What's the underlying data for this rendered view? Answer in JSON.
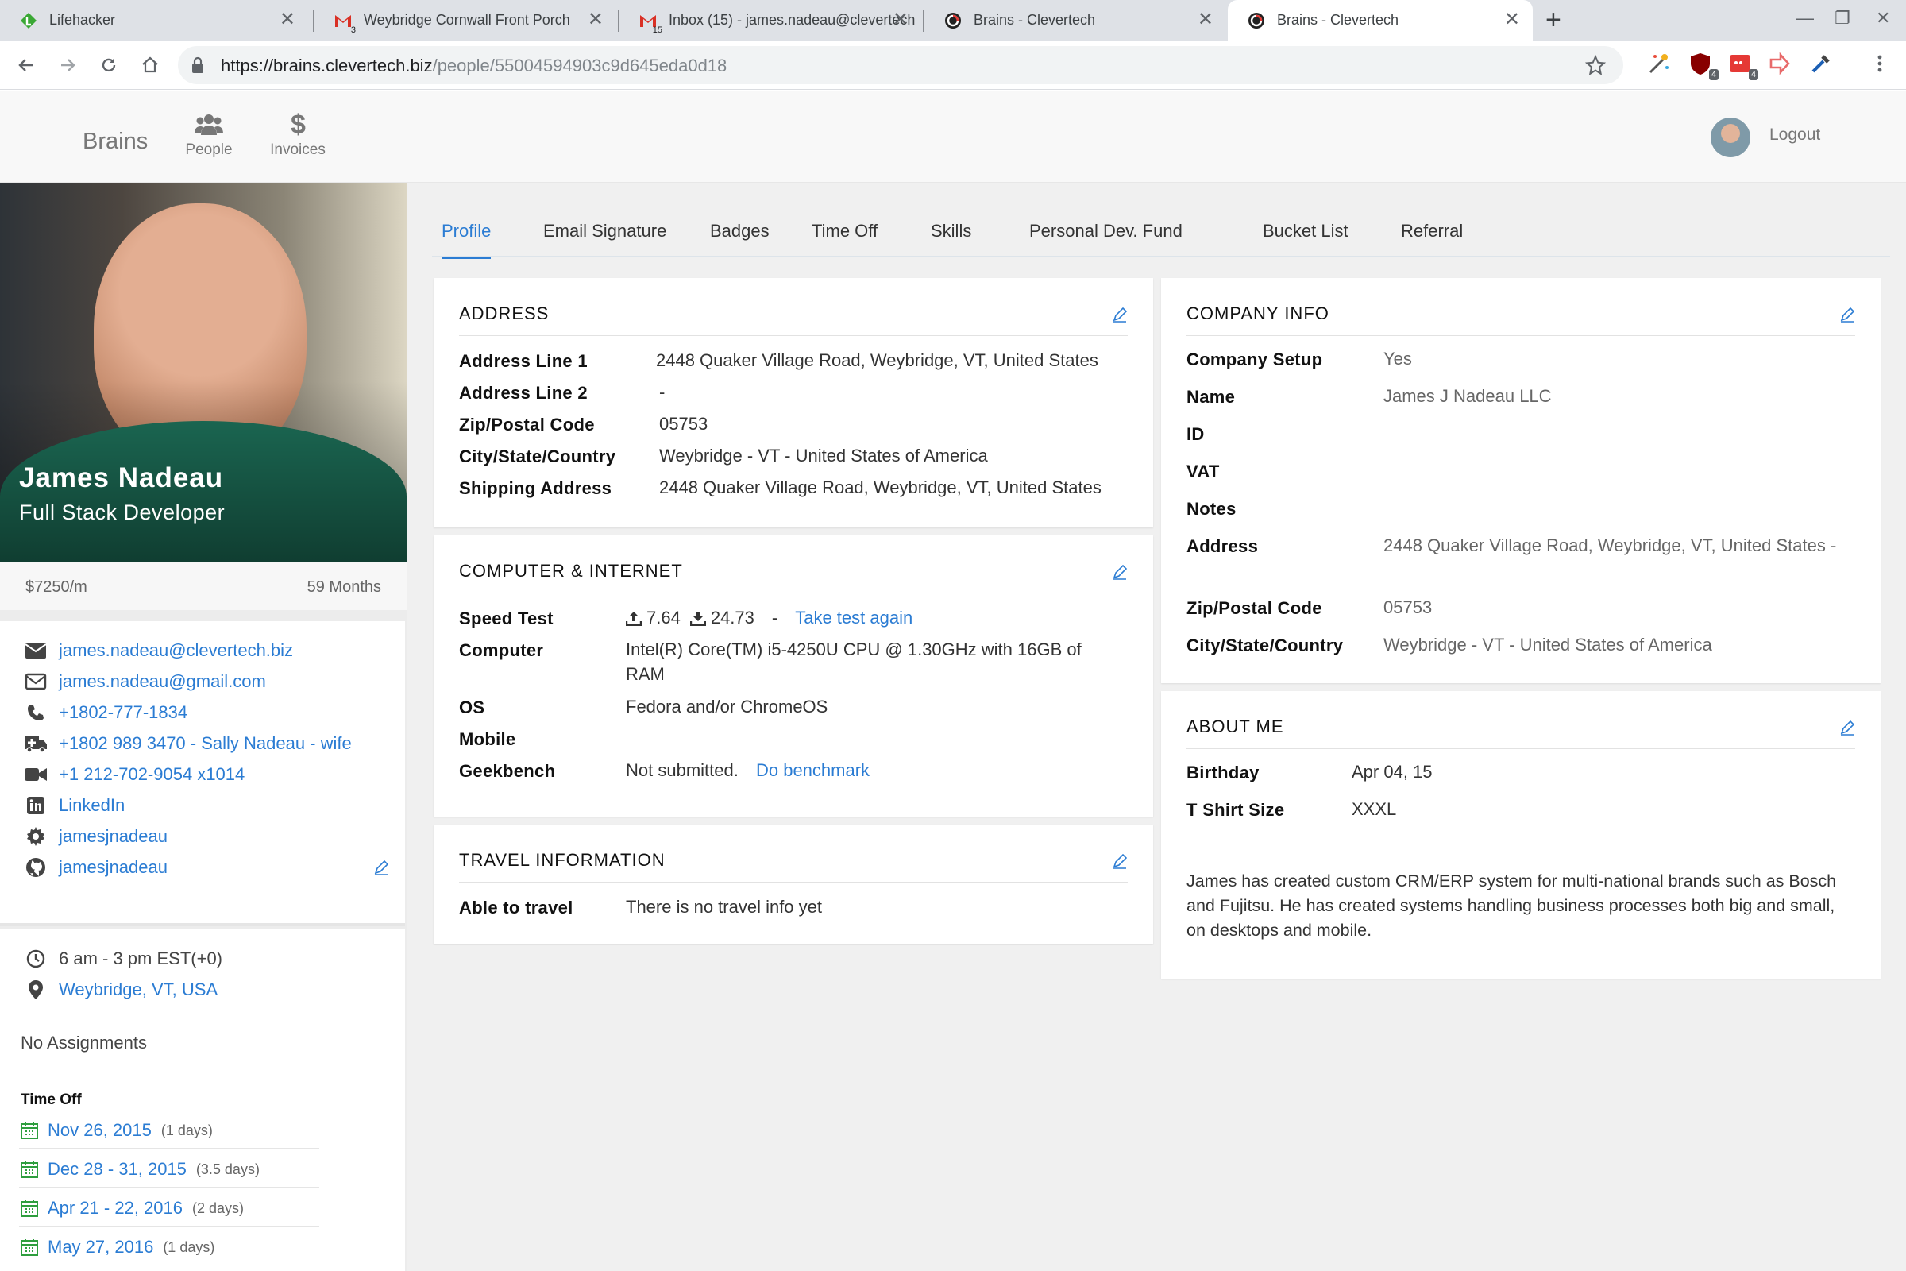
{
  "browser": {
    "tabs": [
      {
        "title": "Lifehacker",
        "favicon": "lifehacker-icon"
      },
      {
        "title": "Weybridge Cornwall Front Porch",
        "favicon": "gmail-icon"
      },
      {
        "title": "Inbox (15) - james.nadeau@clevertech",
        "favicon": "gmail-icon"
      },
      {
        "title": "Brains - Clevertech",
        "favicon": "clevertech-icon"
      },
      {
        "title": "Brains - Clevertech",
        "favicon": "clevertech-icon",
        "active": true
      }
    ],
    "gmail_count_1": "3",
    "gmail_count_2": "15",
    "new_tab": "+",
    "close": "✕",
    "minimize": "—",
    "restore": "❐",
    "win_close": "✕",
    "url_host": "https://brains.clevertech.biz",
    "url_path": "/people/55004594903c9d645eda0d18",
    "extension_badges": [
      "4",
      "4"
    ]
  },
  "appnav": {
    "brand": "Brains",
    "people": "People",
    "invoices": "Invoices",
    "logout": "Logout"
  },
  "profile": {
    "name": "James Nadeau",
    "role": "Full Stack Developer",
    "rate": "$7250/m",
    "tenure": "59 Months",
    "contacts": [
      {
        "icon": "envelope-icon",
        "text": "james.nadeau@clevertech.biz"
      },
      {
        "icon": "envelope-outline-icon",
        "text": "james.nadeau@gmail.com"
      },
      {
        "icon": "phone-icon",
        "text": "+1802-777-1834"
      },
      {
        "icon": "ambulance-icon",
        "text": "+1802 989 3470 - Sally Nadeau - wife"
      },
      {
        "icon": "video-camera-icon",
        "text": "+1 212-702-9054 x1014"
      },
      {
        "icon": "linkedin-icon",
        "text": "LinkedIn"
      },
      {
        "icon": "gear-icon",
        "text": "jamesjnadeau"
      },
      {
        "icon": "github-icon",
        "text": "jamesjnadeau"
      }
    ],
    "hours": "6 am - 3 pm EST(+0)",
    "location": "Weybridge, VT, USA",
    "assignments": "No Assignments",
    "time_off_title": "Time Off",
    "time_off": [
      {
        "dates": "Nov 26, 2015",
        "duration": "(1 days)"
      },
      {
        "dates": "Dec 28 - 31, 2015",
        "duration": "(3.5 days)"
      },
      {
        "dates": "Apr 21 - 22, 2016",
        "duration": "(2 days)"
      },
      {
        "dates": "May 27, 2016",
        "duration": "(1 days)"
      }
    ]
  },
  "tabs": [
    "Profile",
    "Email Signature",
    "Badges",
    "Time Off",
    "Skills",
    "Personal Dev. Fund",
    "Bucket List",
    "Referral"
  ],
  "address": {
    "title": "ADDRESS",
    "rows": [
      {
        "label": "Address Line 1",
        "value": "2448 Quaker Village Road, Weybridge, VT, United States"
      },
      {
        "label": "Address Line 2",
        "value": "-"
      },
      {
        "label": "Zip/Postal Code",
        "value": "05753"
      },
      {
        "label": "City/State/Country",
        "value": "Weybridge - VT - United States of America"
      },
      {
        "label": "Shipping Address",
        "value": "2448 Quaker Village Road, Weybridge, VT, United States"
      }
    ]
  },
  "computer": {
    "title": "COMPUTER & INTERNET",
    "speed_label": "Speed Test",
    "upload": "7.64",
    "download": "24.73",
    "dash": "-",
    "retest": "Take test again",
    "computer_label": "Computer",
    "computer_value": "Intel(R) Core(TM) i5-4250U CPU @ 1.30GHz with 16GB of RAM",
    "os_label": "OS",
    "os_value": "Fedora and/or ChromeOS",
    "mobile_label": "Mobile",
    "geek_label": "Geekbench",
    "geek_value": "Not submitted.",
    "geek_link": "Do benchmark"
  },
  "travel": {
    "title": "TRAVEL INFORMATION",
    "label": "Able to travel",
    "value": "There is no travel info yet"
  },
  "company": {
    "title": "COMPANY INFO",
    "rows": [
      {
        "label": "Company Setup",
        "value": "Yes"
      },
      {
        "label": "Name",
        "value": "James J Nadeau LLC"
      },
      {
        "label": "ID",
        "value": ""
      },
      {
        "label": "VAT",
        "value": ""
      },
      {
        "label": "Notes",
        "value": ""
      },
      {
        "label": "Address",
        "value": "2448 Quaker Village Road, Weybridge, VT, United States -"
      },
      {
        "label": "Zip/Postal Code",
        "value": "05753"
      },
      {
        "label": "City/State/Country",
        "value": "Weybridge - VT - United States of America"
      }
    ]
  },
  "about": {
    "title": "ABOUT ME",
    "birthday_label": "Birthday",
    "birthday": "Apr 04, 15",
    "shirt_label": "T Shirt Size",
    "shirt": "XXXL",
    "bio": "James has created custom CRM/ERP system for multi-national brands such as Bosch and Fujitsu. He has created systems handling business processes both big and small, on desktops and mobile."
  },
  "colors": {
    "link": "#2b7cd3",
    "calendar": "#2e9e3e",
    "background": "#f0f0f0"
  }
}
